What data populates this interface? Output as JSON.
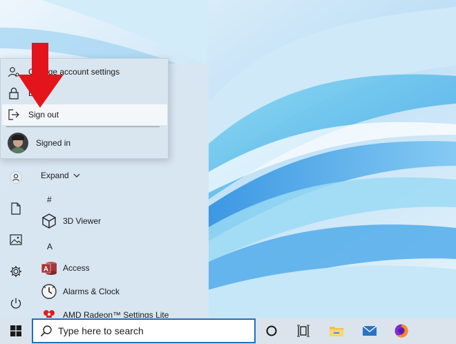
{
  "account_menu": {
    "items": [
      {
        "label": "Change account settings",
        "icon": "user-settings-icon"
      },
      {
        "label": "Lock",
        "icon": "lock-icon"
      },
      {
        "label": "Sign out",
        "icon": "sign-out-icon"
      }
    ],
    "user_status": "Signed in"
  },
  "start_menu": {
    "expand_label": "Expand",
    "sections": [
      {
        "letter": "#",
        "apps": [
          {
            "label": "3D Viewer",
            "icon": "3d-viewer-icon"
          }
        ]
      },
      {
        "letter": "A",
        "apps": [
          {
            "label": "Access",
            "icon": "access-icon"
          },
          {
            "label": "Alarms & Clock",
            "icon": "alarms-clock-icon"
          },
          {
            "label": "AMD Radeon™ Settings Lite",
            "icon": "amd-radeon-icon"
          }
        ]
      }
    ],
    "rail_icons": [
      "user-icon",
      "documents-icon",
      "pictures-icon",
      "settings-icon",
      "power-icon"
    ]
  },
  "taskbar": {
    "search_placeholder": "Type here to search",
    "icons": [
      "windows-start-icon",
      "cortana-icon",
      "task-view-icon",
      "file-explorer-icon",
      "mail-icon",
      "firefox-icon"
    ]
  },
  "colors": {
    "accent": "#1f6fb8",
    "arrow": "#e3141b",
    "access_brand": "#a4373a",
    "amd_brand": "#d71f26"
  }
}
